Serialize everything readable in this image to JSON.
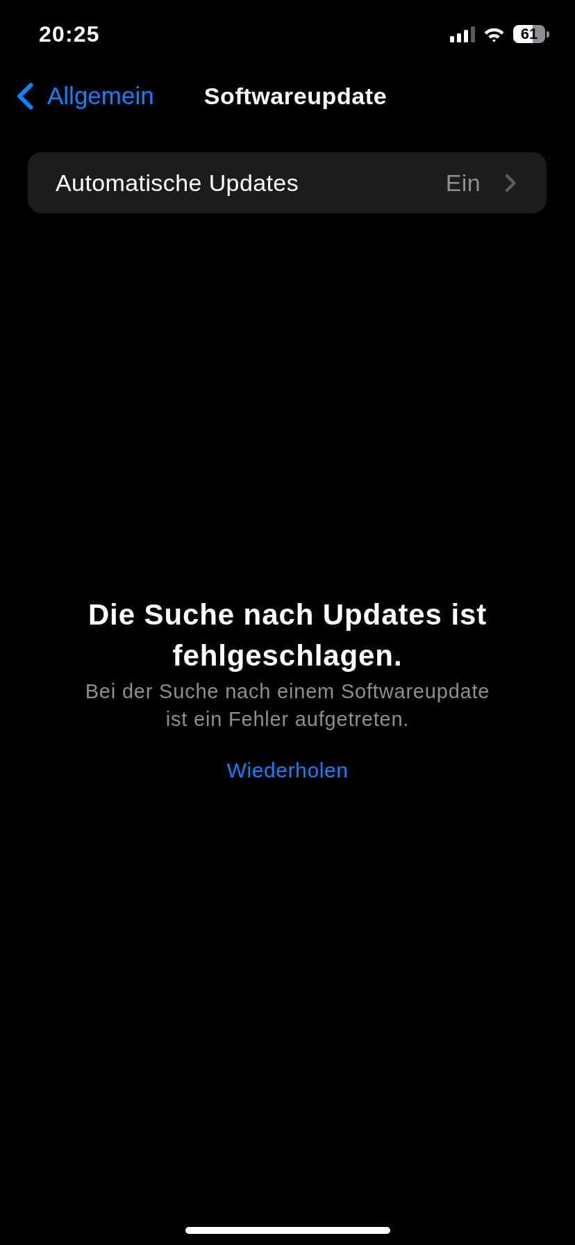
{
  "status_bar": {
    "time": "20:25",
    "battery": "61"
  },
  "nav_bar": {
    "back_label": "Allgemein",
    "title": "Softwareupdate"
  },
  "settings_rows": [
    {
      "label": "Automatische Updates",
      "value": "Ein"
    }
  ],
  "message": {
    "title": "Die Suche nach Updates ist fehlgeschlagen.",
    "body": "Bei der Suche nach einem Softwareupdate ist ein Fehler aufgetreten.",
    "action": "Wiederholen"
  }
}
